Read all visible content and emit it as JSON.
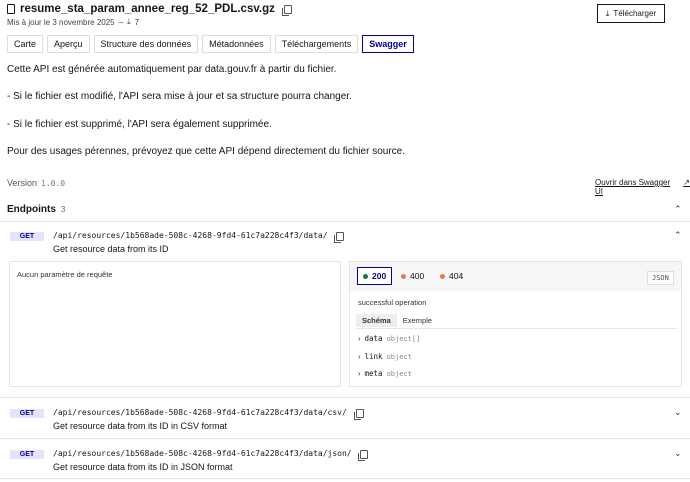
{
  "file": {
    "name": "resume_sta_param_annee_reg_52_PDL.csv.gz",
    "updated": "Mis à jour le 3 novembre 2025",
    "separator": "–",
    "downloads": "7"
  },
  "download_button": "Télécharger",
  "tabs": [
    {
      "label": "Carte",
      "active": false
    },
    {
      "label": "Aperçu",
      "active": false
    },
    {
      "label": "Structure des données",
      "active": false
    },
    {
      "label": "Métadonnées",
      "active": false
    },
    {
      "label": "Téléchargements",
      "active": false
    },
    {
      "label": "Swagger",
      "active": true
    }
  ],
  "description": {
    "intro": "Cette API est générée automatiquement par data.gouv.fr à partir du fichier.",
    "modified": "- Si le fichier est modifié, l'API sera mise à jour et sa structure pourra changer.",
    "deleted": "- Si le fichier est supprimé, l'API sera également supprimée.",
    "perennial": "Pour des usages pérennes, prévoyez que cette API dépend directement du fichier source."
  },
  "version": {
    "label": "Version",
    "value": "1.0.0"
  },
  "swagger_link": "Ouvrir dans Swagger UI",
  "endpoints": {
    "title": "Endpoints",
    "count": "3",
    "items": [
      {
        "method": "GET",
        "path": "/api/resources/1b568ade-508c-4268-9fd4-61c7a228c4f3/data/",
        "summary": "Get resource data from its ID"
      },
      {
        "method": "GET",
        "path": "/api/resources/1b568ade-508c-4268-9fd4-61c7a228c4f3/data/csv/",
        "summary": "Get resource data from its ID in CSV format"
      },
      {
        "method": "GET",
        "path": "/api/resources/1b568ade-508c-4268-9fd4-61c7a228c4f3/data/json/",
        "summary": "Get resource data from its ID in JSON format"
      }
    ]
  },
  "params": {
    "empty": "Aucun paramètre de requête"
  },
  "responses": {
    "codes": [
      {
        "code": "200",
        "color": "#18753c",
        "selected": true
      },
      {
        "code": "400",
        "color": "#e4794a",
        "selected": false
      },
      {
        "code": "404",
        "color": "#e4794a",
        "selected": false
      }
    ],
    "format": "JSON",
    "description": "successful operation",
    "schema_tab": "Schéma",
    "example_tab": "Exemple",
    "fields": [
      {
        "name": "data",
        "type": "object[]"
      },
      {
        "name": "link",
        "type": "object"
      },
      {
        "name": "meta",
        "type": "object"
      }
    ]
  },
  "colors": {
    "accent": "#000091",
    "badge_bg": "#e3e3fd",
    "border": "#e5e5e5"
  }
}
